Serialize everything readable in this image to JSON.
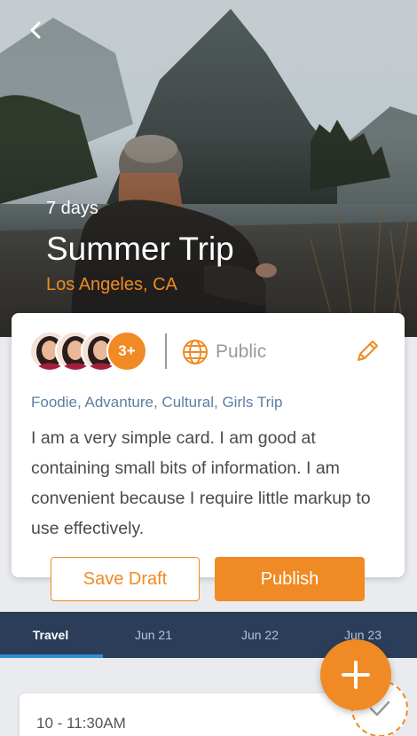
{
  "hero": {
    "duration": "7 days",
    "title": "Summer Trip",
    "location": "Los Angeles, CA"
  },
  "card": {
    "more_members": "3+",
    "visibility": "Public",
    "tags": "Foodie, Advanture, Cultural, Girls Trip",
    "description": "I am a very simple card. I am good at containing small bits of information. I am convenient because I require little markup to use effectively.",
    "save_draft_label": "Save Draft",
    "publish_label": "Publish"
  },
  "tabs": [
    {
      "label": "Travel",
      "active": true
    },
    {
      "label": "Jun 21",
      "active": false
    },
    {
      "label": "Jun 22",
      "active": false
    },
    {
      "label": "Jun 23",
      "active": false
    }
  ],
  "events": [
    {
      "time": "10 - 11:30AM"
    }
  ],
  "colors": {
    "accent": "#f08a24",
    "tabbar": "#2b3d59",
    "tab_indicator": "#2d8ed0",
    "tags": "#5b7fa3"
  },
  "icons": {
    "back": "chevron-left-icon",
    "visibility": "globe-icon",
    "edit": "pencil-icon",
    "fab": "plus-icon",
    "complete": "check-icon"
  }
}
